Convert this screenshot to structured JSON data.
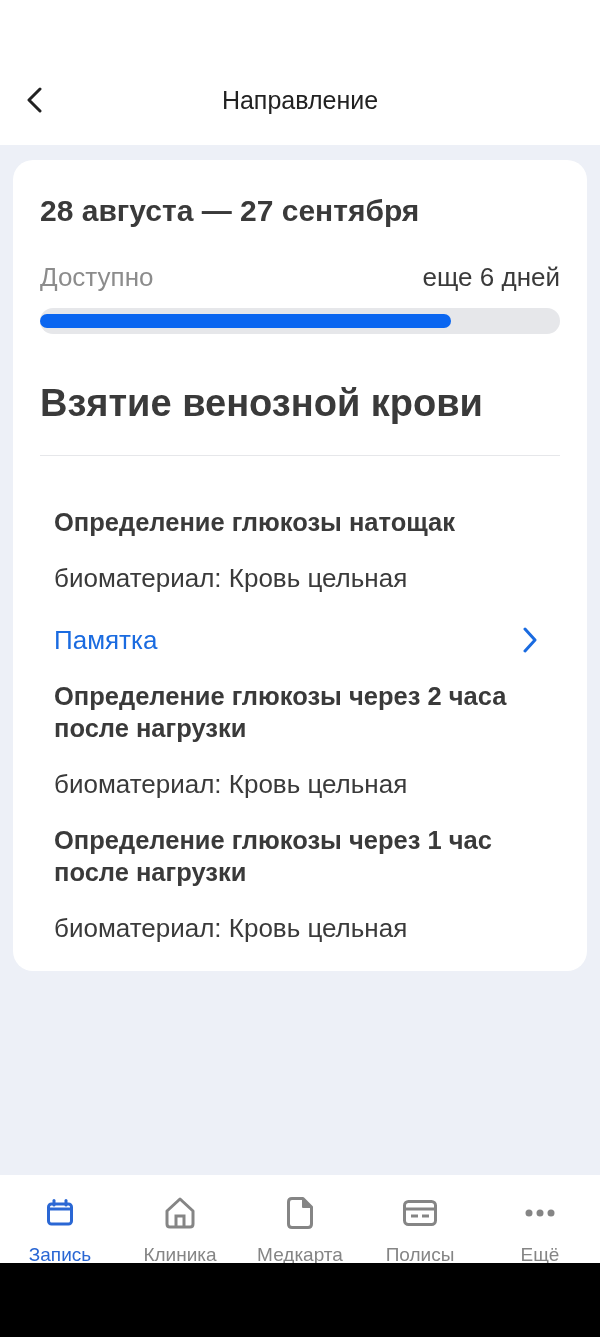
{
  "header": {
    "title": "Направление"
  },
  "referral": {
    "period": "28 августа — 27 сентября",
    "availability_label": "Доступно",
    "remaining": "еще 6 дней",
    "level": 0.79
  },
  "procedure": {
    "title": "Взятие венозной крови",
    "tests": [
      {
        "name": "Определение глюкозы натощак",
        "biomaterial": "биоматериал: Кровь цельная",
        "memo_link": "Памятка"
      },
      {
        "name": "Определение глюкозы через 2 часа после нагрузки",
        "biomaterial": "биоматериал: Кровь цельная"
      },
      {
        "name": "Определение глюкозы через 1 час после нагрузки",
        "biomaterial": "биоматериал: Кровь цельная"
      }
    ]
  },
  "nav": [
    {
      "label": "Запись",
      "selected": true
    },
    {
      "label": "Клиника",
      "selected": false
    },
    {
      "label": "Медкарта",
      "selected": false
    },
    {
      "label": "Полисы",
      "selected": false
    },
    {
      "label": "Ещё",
      "selected": false
    }
  ]
}
